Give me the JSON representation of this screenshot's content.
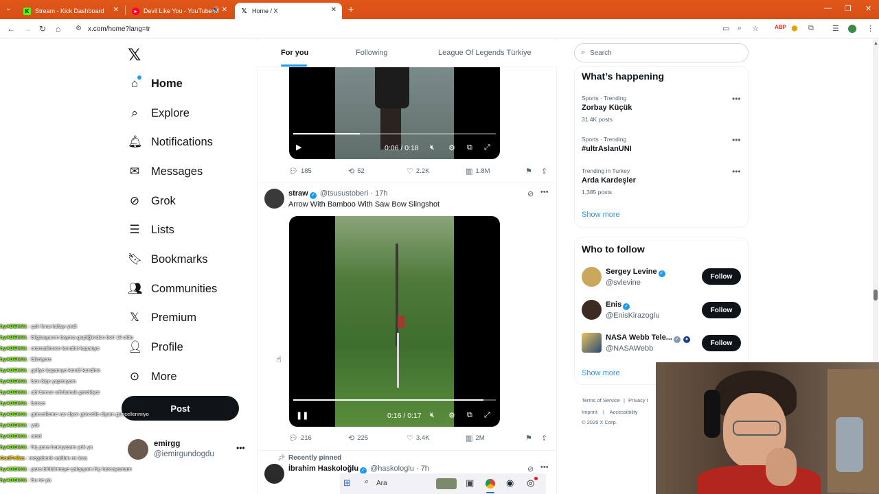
{
  "browser": {
    "tabs": [
      {
        "title": "Stream - Kick Dashboard",
        "favicon": "kick-icon",
        "color": "#53fc18"
      },
      {
        "title": "Devil Like You - YouTube M",
        "favicon": "youtube-music-icon",
        "color": "#ff0033"
      },
      {
        "title": "Home / X",
        "favicon": "x-icon",
        "color": "#000000"
      }
    ],
    "url": "x.com/home?lang=tr"
  },
  "nav": {
    "items": [
      {
        "label": "Home",
        "icon": "home-icon"
      },
      {
        "label": "Explore",
        "icon": "search-icon"
      },
      {
        "label": "Notifications",
        "icon": "bell-icon"
      },
      {
        "label": "Messages",
        "icon": "mail-icon"
      },
      {
        "label": "Grok",
        "icon": "grok-icon"
      },
      {
        "label": "Lists",
        "icon": "list-icon"
      },
      {
        "label": "Bookmarks",
        "icon": "bookmark-icon"
      },
      {
        "label": "Communities",
        "icon": "people-icon"
      },
      {
        "label": "Premium",
        "icon": "x-icon"
      },
      {
        "label": "Profile",
        "icon": "person-icon"
      },
      {
        "label": "More",
        "icon": "more-icon"
      }
    ],
    "post_label": "Post",
    "account": {
      "name": "emirgg",
      "handle": "@iemirgundogdu"
    }
  },
  "chat": [
    {
      "user": "byADEM31",
      "msg": "çok fena kafayı yedi"
    },
    {
      "user": "byADEM31",
      "msg": "bilgisayarım bayma geçtiğimden beri 13 oldu"
    },
    {
      "user": "byADEM31",
      "msg": "otomatikmen kendini kapatıyo"
    },
    {
      "user": "byADEM31",
      "msg": "bilmiyom"
    },
    {
      "user": "byADEM31",
      "msg": "geliyo kapanıyo kendi kendine"
    },
    {
      "user": "byADEM31",
      "msg": "ben bişe yapmıyom"
    },
    {
      "user": "byADEM31",
      "msg": "abi bence sıfırlamak gerekiyor"
    },
    {
      "user": "byADEM31",
      "msg": "bence"
    },
    {
      "user": "byADEM31",
      "msg": "güncelleme var diyor güncelle diyom güncellenmiyo"
    },
    {
      "user": "byADEM31",
      "msg": "yok"
    },
    {
      "user": "byADEM31",
      "msg": "amd"
    },
    {
      "user": "byADEM31",
      "msg": "hiç para harcıyasım yok ya"
    },
    {
      "user": "GodFellas",
      "msg": "megabonk saldım mı kıra"
    },
    {
      "user": "byADEM31",
      "msg": "para biriktirmeye çalışıyom hiç harcayamam"
    },
    {
      "user": "byADEM31",
      "msg": "bu ne ya"
    }
  ],
  "feed": {
    "tabs": [
      "For you",
      "Following",
      "League Of Legends Türkiye"
    ],
    "tweet1": {
      "video_time": "0:06 / 0:18",
      "video_progress": 0.33,
      "replies": "185",
      "reposts": "52",
      "likes": "2.2K",
      "views": "1.8M"
    },
    "tweet2": {
      "name": "straw",
      "handle": "@tsusustoberi",
      "time": "· 17h",
      "text": "Arrow With Bamboo With Saw Bow Slingshot",
      "video_time": "0:16 / 0:17",
      "video_progress": 0.94,
      "replies": "216",
      "reposts": "225",
      "likes": "3.4K",
      "views": "2M"
    },
    "tweet3": {
      "pinned_label": "Recently pinned",
      "name": "İbrahim Haskoloğlu",
      "handle": "@haskologlu",
      "time": "· 7h"
    }
  },
  "sidebar": {
    "search_placeholder": "Search",
    "happening_title": "What’s happening",
    "trends": [
      {
        "meta": "Sports · Trending",
        "title": "Zorbay Küçük",
        "posts": "31.4K posts"
      },
      {
        "meta": "Sports · Trending",
        "title": "#ultrAslanUNI",
        "posts": ""
      },
      {
        "meta": "Trending in Turkey",
        "title": "Arda Kardeşler",
        "posts": "1,385 posts"
      }
    ],
    "show_more": "Show more",
    "wtf_title": "Who to follow",
    "follow_label": "Follow",
    "suggestions": [
      {
        "name": "Sergey Levine",
        "handle": "@svlevine"
      },
      {
        "name": "Enis",
        "handle": "@EnisKirazoglu"
      },
      {
        "name": "NASA Webb Tele...",
        "handle": "@NASAWebb"
      }
    ],
    "footer": {
      "terms": "Terms of Service",
      "privacy": "Privacy I",
      "imprint": "Imprint",
      "accessibility": "Accessibility",
      "copyright": "© 2025 X Corp."
    }
  },
  "taskbar": {
    "search_label": "Ara"
  }
}
